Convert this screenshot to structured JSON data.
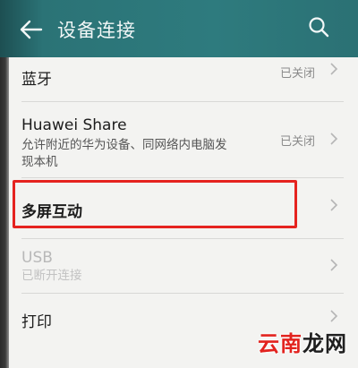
{
  "header": {
    "title": "设备连接",
    "back_icon": "arrow-left-icon",
    "search_icon": "search-icon"
  },
  "items": [
    {
      "label": "蓝牙",
      "status": "已关闭"
    },
    {
      "label": "Huawei Share",
      "description": "允许附近的华为设备、同网络内电脑发现本机",
      "status": "已关闭"
    },
    {
      "label": "多屏互动"
    },
    {
      "label": "USB",
      "description": "已断开连接"
    },
    {
      "label": "打印"
    }
  ],
  "watermark": {
    "part1": "云南",
    "part2": "龙网"
  },
  "colors": {
    "appbar": "#2e7b7e",
    "highlight": "#e5231f"
  }
}
